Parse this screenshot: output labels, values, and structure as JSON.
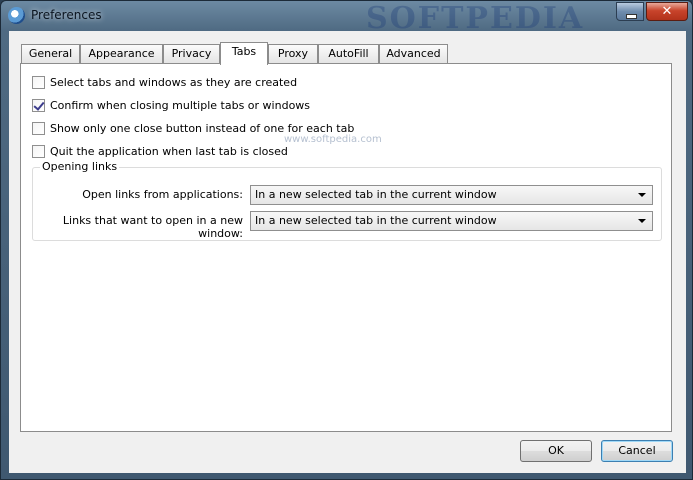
{
  "window": {
    "title": "Preferences",
    "watermark": "SOFTPEDIA",
    "watermark_small": "www.softpedia.com"
  },
  "titlebar": {
    "close_glyph": "✕"
  },
  "tabs": [
    {
      "label": "General"
    },
    {
      "label": "Appearance"
    },
    {
      "label": "Privacy"
    },
    {
      "label": "Tabs",
      "active": true
    },
    {
      "label": "Proxy"
    },
    {
      "label": "AutoFill"
    },
    {
      "label": "Advanced"
    }
  ],
  "options": [
    {
      "label": "Select tabs and windows as they are created",
      "checked": false
    },
    {
      "label": "Confirm when closing multiple tabs or windows",
      "checked": true
    },
    {
      "label": "Show only one close button instead of one for each tab",
      "checked": false
    },
    {
      "label": "Quit the application when last tab is closed",
      "checked": false
    }
  ],
  "opening_links": {
    "title": "Opening links",
    "from_apps_label": "Open links from applications:",
    "from_apps_value": "In a new selected tab in the current window",
    "new_window_label": "Links that want to open in a new window:",
    "new_window_value": "In a new selected tab in the current window"
  },
  "buttons": {
    "ok": "OK",
    "cancel": "Cancel"
  }
}
